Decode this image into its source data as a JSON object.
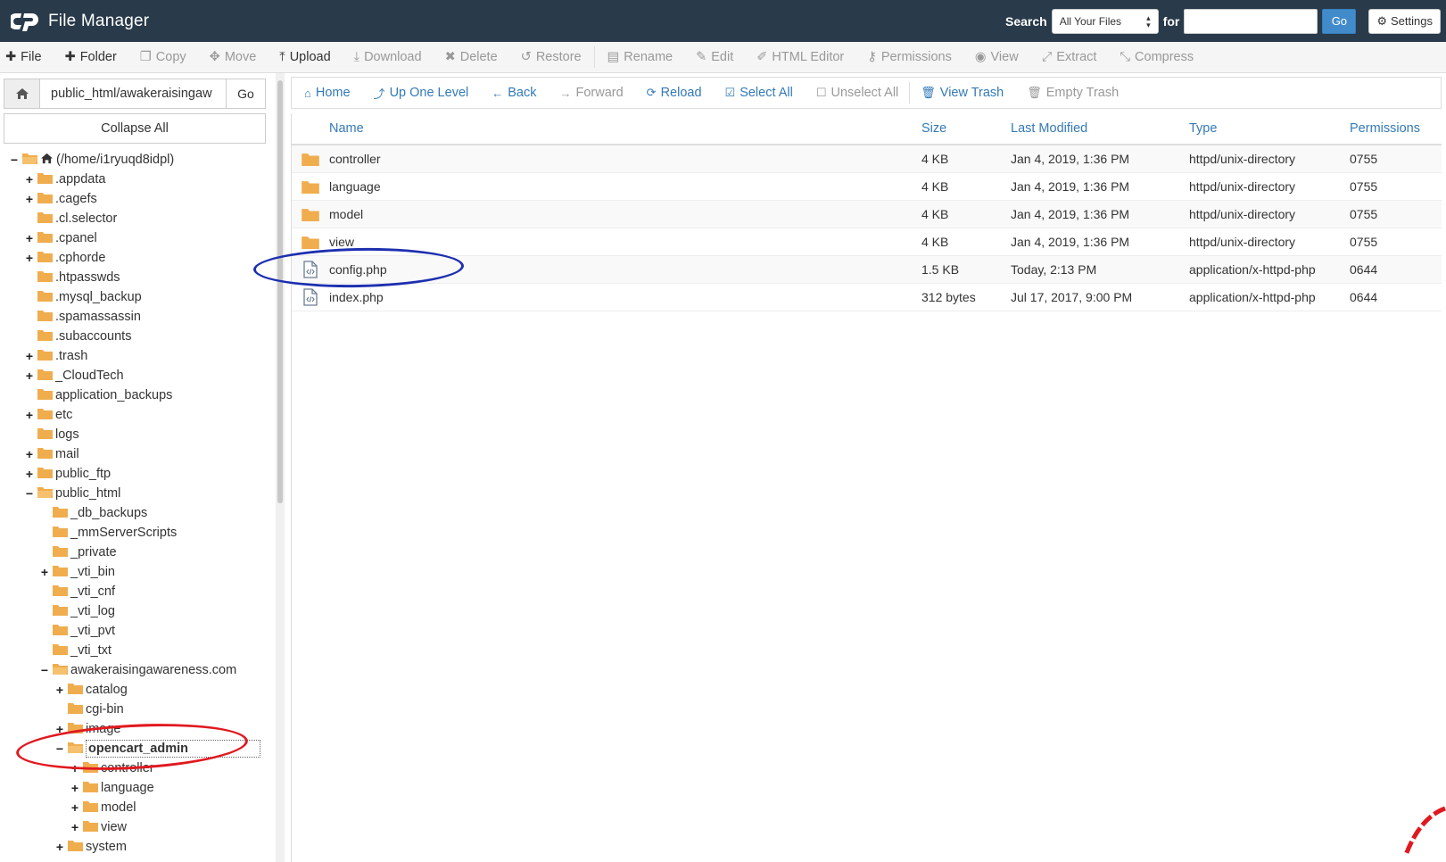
{
  "header": {
    "app_title": "File Manager",
    "search_label": "Search",
    "search_scope": "All Your Files",
    "search_for_label": "for",
    "search_value": "",
    "go_label": "Go",
    "settings_label": "Settings"
  },
  "toolbar": {
    "items": [
      {
        "label": "File",
        "icon": "plus-icon",
        "active": true
      },
      {
        "label": "Folder",
        "icon": "plus-icon",
        "active": true
      },
      {
        "label": "Copy",
        "icon": "copy-icon",
        "active": false
      },
      {
        "label": "Move",
        "icon": "move-icon",
        "active": false
      },
      {
        "label": "Upload",
        "icon": "upload-icon",
        "active": true
      },
      {
        "label": "Download",
        "icon": "download-icon",
        "active": false
      },
      {
        "label": "Delete",
        "icon": "delete-icon",
        "active": false
      },
      {
        "label": "Restore",
        "icon": "restore-icon",
        "active": false
      },
      {
        "label": "Rename",
        "icon": "rename-icon",
        "active": false
      },
      {
        "label": "Edit",
        "icon": "edit-icon",
        "active": false
      },
      {
        "label": "HTML Editor",
        "icon": "html-editor-icon",
        "active": false
      },
      {
        "label": "Permissions",
        "icon": "key-icon",
        "active": false
      },
      {
        "label": "View",
        "icon": "eye-icon",
        "active": false
      },
      {
        "label": "Extract",
        "icon": "extract-icon",
        "active": false
      },
      {
        "label": "Compress",
        "icon": "compress-icon",
        "active": false
      }
    ]
  },
  "sidebar": {
    "path_value": "public_html/awakeraisingaw",
    "path_go_label": "Go",
    "collapse_label": "Collapse All",
    "tree": [
      {
        "label": "(/home/i1ryuqd8idpl)",
        "depth": 0,
        "expander": "−",
        "home": true,
        "open": true
      },
      {
        "label": ".appdata",
        "depth": 1,
        "expander": "+"
      },
      {
        "label": ".cagefs",
        "depth": 1,
        "expander": "+"
      },
      {
        "label": ".cl.selector",
        "depth": 1,
        "expander": ""
      },
      {
        "label": ".cpanel",
        "depth": 1,
        "expander": "+"
      },
      {
        "label": ".cphorde",
        "depth": 1,
        "expander": "+"
      },
      {
        "label": ".htpasswds",
        "depth": 1,
        "expander": ""
      },
      {
        "label": ".mysql_backup",
        "depth": 1,
        "expander": ""
      },
      {
        "label": ".spamassassin",
        "depth": 1,
        "expander": ""
      },
      {
        "label": ".subaccounts",
        "depth": 1,
        "expander": ""
      },
      {
        "label": ".trash",
        "depth": 1,
        "expander": "+"
      },
      {
        "label": "_CloudTech",
        "depth": 1,
        "expander": "+"
      },
      {
        "label": "application_backups",
        "depth": 1,
        "expander": ""
      },
      {
        "label": "etc",
        "depth": 1,
        "expander": "+"
      },
      {
        "label": "logs",
        "depth": 1,
        "expander": ""
      },
      {
        "label": "mail",
        "depth": 1,
        "expander": "+"
      },
      {
        "label": "public_ftp",
        "depth": 1,
        "expander": "+"
      },
      {
        "label": "public_html",
        "depth": 1,
        "expander": "−",
        "open": true
      },
      {
        "label": "_db_backups",
        "depth": 2,
        "expander": ""
      },
      {
        "label": "_mmServerScripts",
        "depth": 2,
        "expander": ""
      },
      {
        "label": "_private",
        "depth": 2,
        "expander": ""
      },
      {
        "label": "_vti_bin",
        "depth": 2,
        "expander": "+"
      },
      {
        "label": "_vti_cnf",
        "depth": 2,
        "expander": ""
      },
      {
        "label": "_vti_log",
        "depth": 2,
        "expander": ""
      },
      {
        "label": "_vti_pvt",
        "depth": 2,
        "expander": ""
      },
      {
        "label": "_vti_txt",
        "depth": 2,
        "expander": ""
      },
      {
        "label": "awakeraisingawareness.com",
        "depth": 2,
        "expander": "−",
        "open": true
      },
      {
        "label": "catalog",
        "depth": 3,
        "expander": "+"
      },
      {
        "label": "cgi-bin",
        "depth": 3,
        "expander": ""
      },
      {
        "label": "image",
        "depth": 3,
        "expander": "+"
      },
      {
        "label": "opencart_admin",
        "depth": 3,
        "expander": "−",
        "open": true,
        "selected": true
      },
      {
        "label": "controller",
        "depth": 4,
        "expander": "+"
      },
      {
        "label": "language",
        "depth": 4,
        "expander": "+"
      },
      {
        "label": "model",
        "depth": 4,
        "expander": "+"
      },
      {
        "label": "view",
        "depth": 4,
        "expander": "+"
      },
      {
        "label": "system",
        "depth": 3,
        "expander": "+"
      }
    ]
  },
  "nav": {
    "items": [
      {
        "label": "Home",
        "icon": "home-icon",
        "disabled": false
      },
      {
        "label": "Up One Level",
        "icon": "level-up-icon",
        "disabled": false
      },
      {
        "label": "Back",
        "icon": "arrow-left-icon",
        "disabled": false
      },
      {
        "label": "Forward",
        "icon": "arrow-right-icon",
        "disabled": true
      },
      {
        "label": "Reload",
        "icon": "reload-icon",
        "disabled": false
      },
      {
        "label": "Select All",
        "icon": "checkbox-checked-icon",
        "disabled": false
      },
      {
        "label": "Unselect All",
        "icon": "checkbox-empty-icon",
        "disabled": true
      },
      {
        "label": "View Trash",
        "icon": "trash-icon",
        "disabled": false
      },
      {
        "label": "Empty Trash",
        "icon": "trash-icon",
        "disabled": true
      }
    ]
  },
  "table": {
    "columns": [
      "Name",
      "Size",
      "Last Modified",
      "Type",
      "Permissions"
    ],
    "rows": [
      {
        "kind": "folder",
        "name": "controller",
        "size": "4 KB",
        "modified": "Jan 4, 2019, 1:36 PM",
        "type": "httpd/unix-directory",
        "perms": "0755"
      },
      {
        "kind": "folder",
        "name": "language",
        "size": "4 KB",
        "modified": "Jan 4, 2019, 1:36 PM",
        "type": "httpd/unix-directory",
        "perms": "0755"
      },
      {
        "kind": "folder",
        "name": "model",
        "size": "4 KB",
        "modified": "Jan 4, 2019, 1:36 PM",
        "type": "httpd/unix-directory",
        "perms": "0755"
      },
      {
        "kind": "folder",
        "name": "view",
        "size": "4 KB",
        "modified": "Jan 4, 2019, 1:36 PM",
        "type": "httpd/unix-directory",
        "perms": "0755"
      },
      {
        "kind": "file",
        "name": "config.php",
        "size": "1.5 KB",
        "modified": "Today, 2:13 PM",
        "type": "application/x-httpd-php",
        "perms": "0644"
      },
      {
        "kind": "file",
        "name": "index.php",
        "size": "312 bytes",
        "modified": "Jul 17, 2017, 9:00 PM",
        "type": "application/x-httpd-php",
        "perms": "0644"
      }
    ]
  },
  "colors": {
    "header_bg": "#293a4a",
    "link": "#337ab7",
    "folder": "#f0ad4e",
    "annotation_blue": "#1d2fb0",
    "annotation_red": "#e0191f"
  }
}
